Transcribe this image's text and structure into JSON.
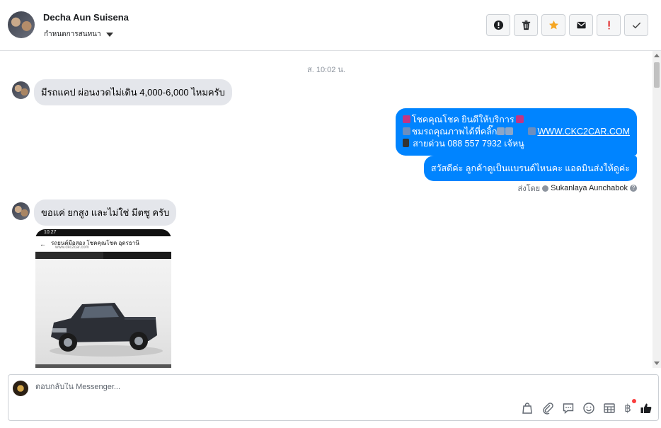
{
  "header": {
    "name": "Decha Aun Suisena",
    "assign_label": "กำหนดการสนทนา",
    "actions": [
      {
        "name": "spam-button",
        "icon": "alert-circle-icon"
      },
      {
        "name": "delete-button",
        "icon": "trash-icon"
      },
      {
        "name": "star-button",
        "icon": "star-icon",
        "color": "#f5a623"
      },
      {
        "name": "mark-unread-button",
        "icon": "envelope-icon"
      },
      {
        "name": "follow-up-button",
        "icon": "exclamation-icon",
        "color": "#e02424"
      },
      {
        "name": "mark-done-button",
        "icon": "checkmark-icon"
      }
    ]
  },
  "conversation": {
    "timestamp": "ส. 10:02 น.",
    "messages": [
      {
        "direction": "in",
        "text": "มีรถแคป ผ่อนงวดไม่เดิน 4,000-6,000 ไหมครับ"
      },
      {
        "direction": "out",
        "lines": {
          "l1": "โชคคุณโชค ยินดีให้บริการ",
          "l2": "ชมรถคุณภาพได้ที่คลิ๊ก",
          "l2_link": "WWW.CKC2CAR.COM",
          "l3": "สายด่วน 088 557 7932 เจ้หนู"
        }
      },
      {
        "direction": "out",
        "text": "สวัสดีค่ะ  ลูกค้าดูเป็นแบรนด์ไหนคะ แอดมินส่งให้ดูค่ะ"
      },
      {
        "direction": "in",
        "text": "ขอแค่ ยกสูง และไม่ใช่ มีตซู ครับ"
      }
    ],
    "sent_by_label": "ส่งโดย",
    "sent_by_name": "Sukanlaya Aunchabok",
    "screenshot": {
      "status_time": "10:27",
      "page_title": "รถยนต์มือสอง โชคคุณโชค อุดรธานี",
      "page_url": "www.ckc2car.com"
    }
  },
  "reply": {
    "placeholder": "ตอบกลับใน Messenger...",
    "tools": [
      "shopping-bag-icon",
      "paperclip-icon",
      "saved-reply-icon",
      "emoji-icon",
      "table-icon",
      "baht-payment-icon",
      "like-icon"
    ],
    "baht_symbol": "฿"
  },
  "colors": {
    "outgoing_bubble": "#0084ff",
    "incoming_bubble": "#e4e6eb",
    "star": "#f5a623",
    "follow_up": "#e02424"
  }
}
